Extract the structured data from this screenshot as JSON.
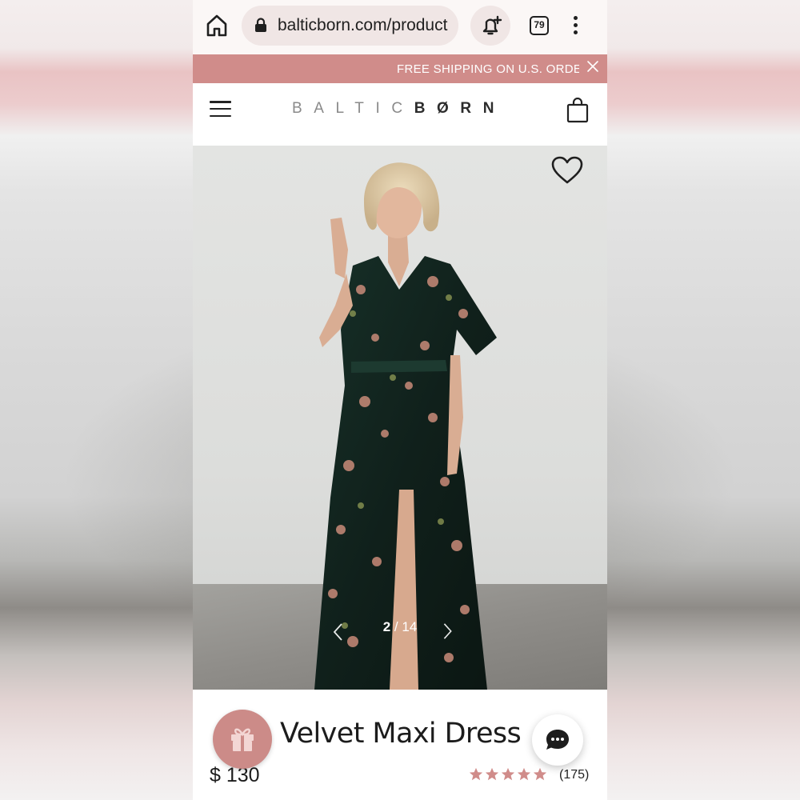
{
  "browser": {
    "url": "balticborn.com/product",
    "tab_count": "79",
    "icons": [
      "home-icon",
      "lock-icon",
      "notification-add-icon",
      "tabs-icon",
      "more-vert-icon"
    ]
  },
  "promo": {
    "text": "FREE SHIPPING ON U.S. ORDERS",
    "close_icon": "close-icon"
  },
  "header": {
    "logo_light": "BALTIC",
    "logo_dark": "BØRN",
    "icons": [
      "hamburger-menu-icon",
      "shopping-bag-icon"
    ]
  },
  "gallery": {
    "current": "2",
    "separator": "/",
    "total": "14",
    "icons": [
      "heart-icon",
      "chevron-left-icon",
      "chevron-right-icon"
    ]
  },
  "product": {
    "title": "Velvet Maxi Dress",
    "price": "$ 130",
    "rating_stars": 5,
    "review_count": "(175)"
  },
  "colors": {
    "accent": "#d08c8a",
    "gift_button": "#cc8b88",
    "star": "#d08c8a",
    "text": "#1c1c1c"
  },
  "widgets": {
    "gift_icon": "gift-icon",
    "chat_icon": "chat-bubble-icon"
  }
}
